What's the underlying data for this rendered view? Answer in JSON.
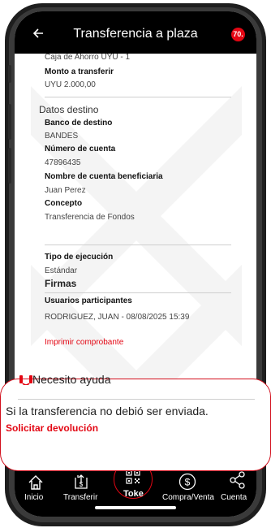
{
  "header": {
    "title": "Transferencia a plaza",
    "badge": "70."
  },
  "origin": {
    "account_partial": "Caja de Ahorro UYU - 1",
    "amount_label": "Monto a transferir",
    "amount_value": "UYU 2.000,00"
  },
  "destination": {
    "section_title": "Datos destino",
    "bank_label": "Banco de destino",
    "bank_value": "BANDES",
    "account_label": "Número de cuenta",
    "account_value": "47896435",
    "holder_label": "Nombre de cuenta beneficiaria",
    "holder_value": "Juan Perez",
    "concept_label": "Concepto",
    "concept_value": "Transferencia de Fondos"
  },
  "execution": {
    "type_label": "Tipo de ejecución",
    "type_value": "Estándar",
    "signatures_label": "Firmas",
    "users_label": "Usuarios participantes",
    "users_value": "RODRIGUEZ, JUAN - 08/08/2025 15:39",
    "print_link": "Imprimir comprobante"
  },
  "help": {
    "title": "Necesito ayuda",
    "description": "Si la transferencia no debió ser enviada.",
    "link": "Solicitar devolución"
  },
  "tabbar": {
    "items": [
      {
        "label": "Inicio",
        "icon": "home-icon"
      },
      {
        "label": "Transferir",
        "icon": "transfer-icon"
      },
      {
        "label": "Toke",
        "icon": "qr-code-icon"
      },
      {
        "label": "Compra/Venta",
        "icon": "dollar-icon"
      },
      {
        "label": "Cuenta",
        "icon": "share-icon"
      }
    ]
  },
  "colors": {
    "brand_red": "#e30613",
    "header_bg": "#000000"
  }
}
